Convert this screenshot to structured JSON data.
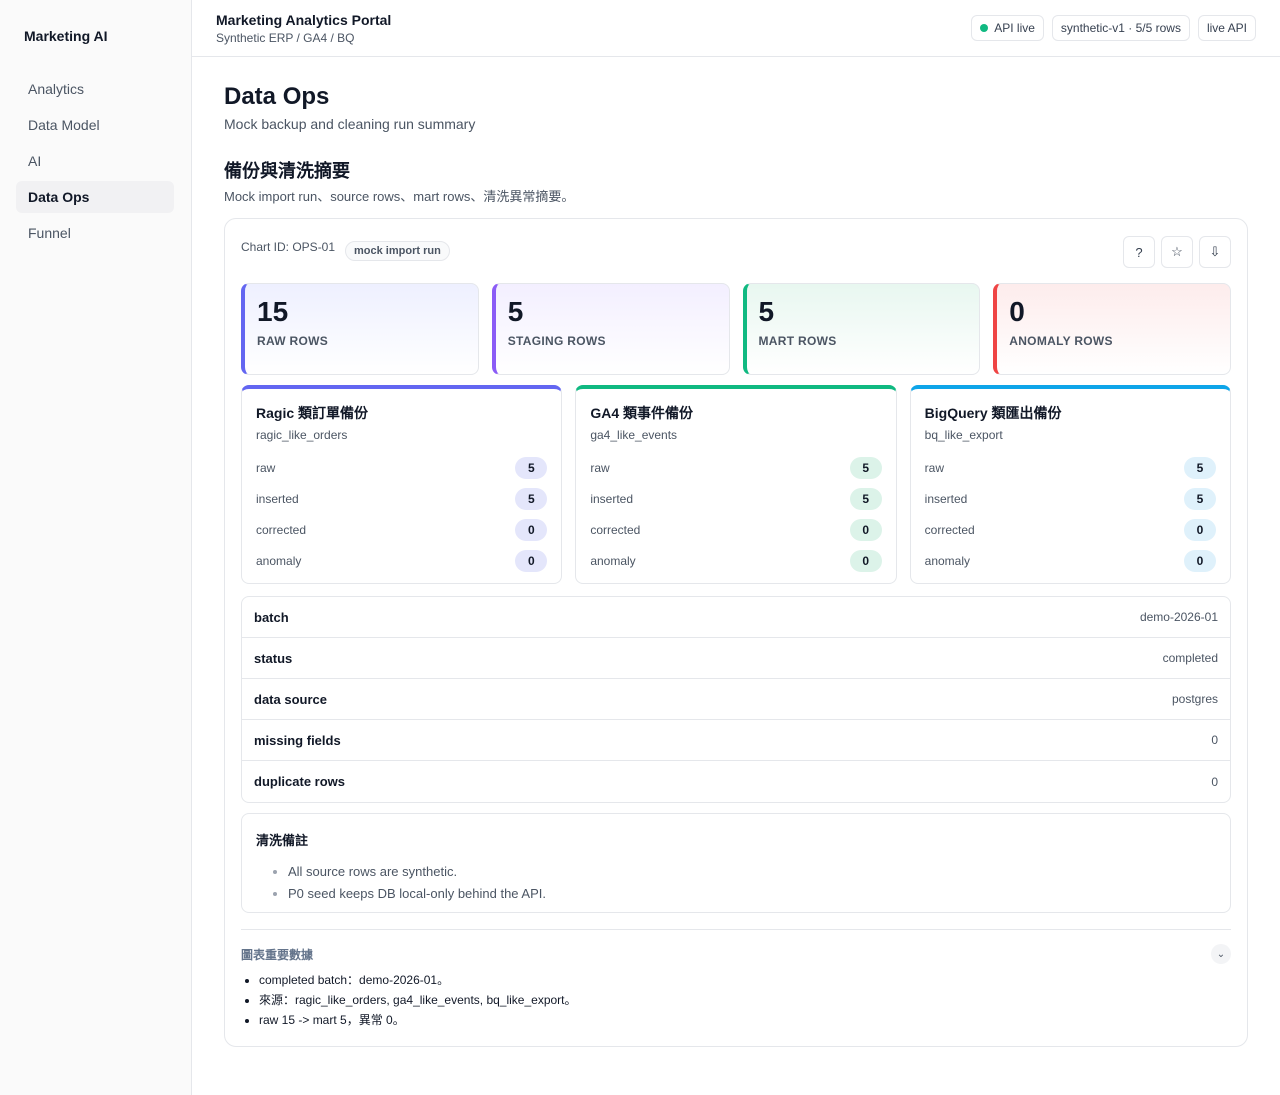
{
  "sidebar": {
    "brand": "Marketing AI",
    "items": [
      {
        "label": "Analytics",
        "active": false
      },
      {
        "label": "Data Model",
        "active": false
      },
      {
        "label": "AI",
        "active": false
      },
      {
        "label": "Data Ops",
        "active": true
      },
      {
        "label": "Funnel",
        "active": false
      }
    ]
  },
  "header": {
    "title": "Marketing Analytics Portal",
    "subtitle": "Synthetic ERP / GA4 / BQ",
    "pills": {
      "api_status": "API live",
      "api_status_color": "#10b981",
      "dataset": "synthetic-v1 · 5/5 rows",
      "mode": "live API"
    }
  },
  "page": {
    "title": "Data Ops",
    "subtitle": "Mock backup and cleaning run summary",
    "section_title": "備份與清洗摘要",
    "section_subtitle": "Mock import run、source rows、mart rows、清洗異常摘要。"
  },
  "card": {
    "chart_id": "Chart ID: OPS-01",
    "tag": "mock import run",
    "buttons": {
      "help": "?",
      "help_icon": "question-icon",
      "favorite": "☆",
      "favorite_icon": "star-icon",
      "download": "⇩",
      "download_icon": "download-icon"
    },
    "kpis": [
      {
        "value": "15",
        "label": "RAW ROWS",
        "accent": "#6366f1",
        "tint": "#eef0ff"
      },
      {
        "value": "5",
        "label": "STAGING ROWS",
        "accent": "#8b5cf6",
        "tint": "#f3efff"
      },
      {
        "value": "5",
        "label": "MART ROWS",
        "accent": "#10b981",
        "tint": "#e8f7f0"
      },
      {
        "value": "0",
        "label": "ANOMALY ROWS",
        "accent": "#ef4444",
        "tint": "#fdecec"
      }
    ],
    "sources": [
      {
        "title": "Ragic 類訂單備份",
        "key": "ragic_like_orders",
        "accent": "#6366f1",
        "badge_bg": "#e4e6fb",
        "rows": [
          {
            "label": "raw",
            "value": "5"
          },
          {
            "label": "inserted",
            "value": "5"
          },
          {
            "label": "corrected",
            "value": "0"
          },
          {
            "label": "anomaly",
            "value": "0"
          }
        ]
      },
      {
        "title": "GA4 類事件備份",
        "key": "ga4_like_events",
        "accent": "#10b981",
        "badge_bg": "#dcf3e9",
        "rows": [
          {
            "label": "raw",
            "value": "5"
          },
          {
            "label": "inserted",
            "value": "5"
          },
          {
            "label": "corrected",
            "value": "0"
          },
          {
            "label": "anomaly",
            "value": "0"
          }
        ]
      },
      {
        "title": "BigQuery 類匯出備份",
        "key": "bq_like_export",
        "accent": "#0ea5e9",
        "badge_bg": "#dff1fb",
        "rows": [
          {
            "label": "raw",
            "value": "5"
          },
          {
            "label": "inserted",
            "value": "5"
          },
          {
            "label": "corrected",
            "value": "0"
          },
          {
            "label": "anomaly",
            "value": "0"
          }
        ]
      }
    ],
    "details": [
      {
        "key": "batch",
        "value": "demo-2026-01"
      },
      {
        "key": "status",
        "value": "completed"
      },
      {
        "key": "data source",
        "value": "postgres"
      },
      {
        "key": "missing fields",
        "value": "0"
      },
      {
        "key": "duplicate rows",
        "value": "0"
      }
    ],
    "notes": {
      "title": "清洗備註",
      "items": [
        "All source rows are synthetic.",
        "P0 seed keeps DB local-only behind the API."
      ]
    },
    "key_data": {
      "title": "圖表重要數據",
      "toggle": "⌄",
      "toggle_icon": "chevron-down-icon",
      "items": [
        "completed batch：demo-2026-01。",
        "來源：ragic_like_orders, ga4_like_events, bq_like_export。",
        "raw 15 -> mart 5，異常 0。"
      ]
    }
  }
}
